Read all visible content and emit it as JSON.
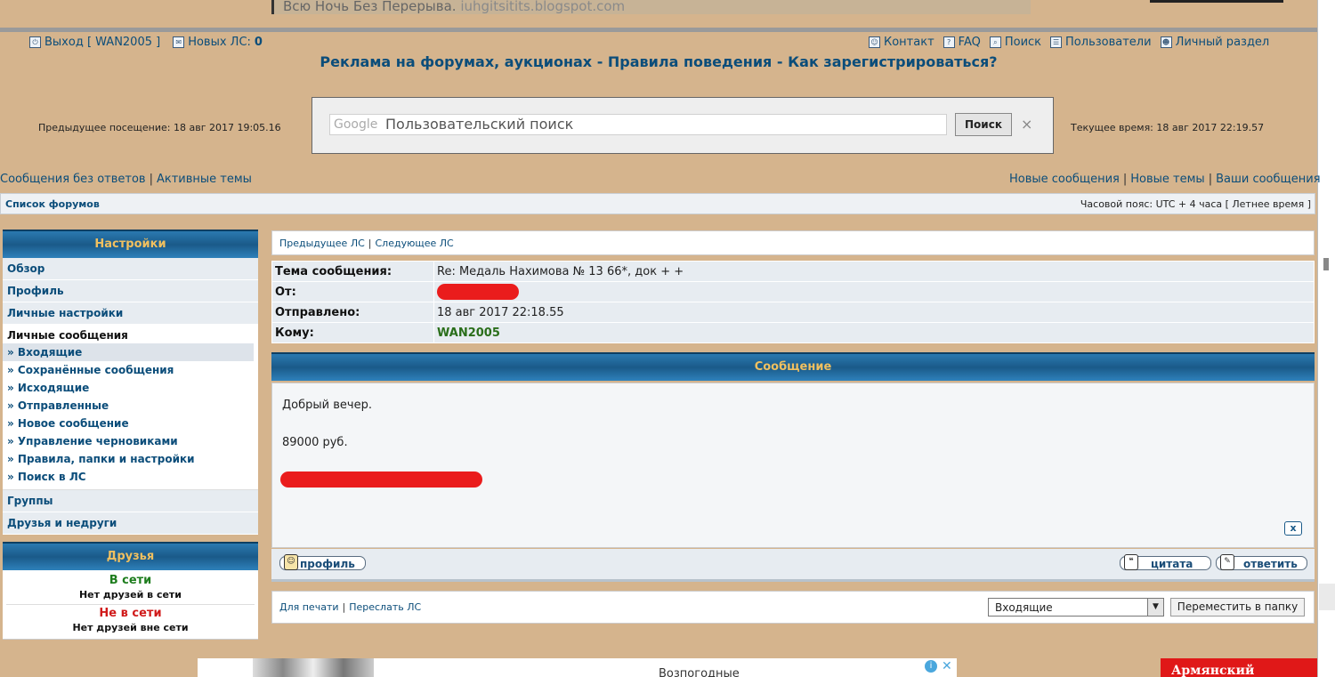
{
  "top_banner": {
    "text": "Всю Ночь Без Перерыва.",
    "link": "iuhgitsitits.blogspot.com"
  },
  "header": {
    "logout": "Выход [ WAN2005 ]",
    "new_pm_label": "Новых ЛС:",
    "new_pm_count": "0",
    "nav": {
      "contact": "Контакт",
      "faq": "FAQ",
      "search": "Поиск",
      "users": "Пользователи",
      "personal": "Личный раздел"
    },
    "headline_1": "Реклама на форумах, аукционах",
    "headline_sep1": " - ",
    "headline_2": "Правила поведения",
    "headline_sep2": " - ",
    "headline_3": "Как зарегистрироваться?",
    "prev_visit": "Предыдущее посещение: 18 авг 2017 19:05.16",
    "current_time": "Текущее время: 18 авг 2017 22:19.57"
  },
  "search": {
    "brand": "Google",
    "placeholder": "Пользовательский поиск",
    "button": "Поиск",
    "close": "×"
  },
  "quick_links": {
    "unanswered": "Сообщения без ответов",
    "active": "Активные темы",
    "new_posts": "Новые сообщения",
    "new_topics": "Новые темы",
    "your_posts": "Ваши сообщения"
  },
  "crumb": {
    "forums": "Список форумов",
    "timezone": "Часовой пояс: UTC + 4 часа [ Летнее время ]"
  },
  "sidebar": {
    "title": "Настройки",
    "items": [
      "Обзор",
      "Профиль",
      "Личные настройки"
    ],
    "pm_title": "Личные сообщения",
    "pm_links": [
      "» Входящие",
      "» Сохранённые сообщения",
      "» Исходящие",
      "» Отправленные",
      "» Новое сообщение",
      "» Управление черновиками",
      "» Правила, папки и настройки",
      "» Поиск в ЛС"
    ],
    "items2": [
      "Группы",
      "Друзья и недруги"
    ],
    "friends_title": "Друзья",
    "online": "В сети",
    "online_none": "Нет друзей в сети",
    "offline": "Не в сети",
    "offline_none": "Нет друзей вне сети"
  },
  "pm_nav": {
    "prev": "Предыдущее ЛС",
    "next": "Следующее ЛС"
  },
  "message": {
    "subject_label": "Тема сообщения:",
    "subject": "Re: Медаль Нахимова № 13 66*, док + +",
    "from_label": "От:",
    "sent_label": "Отправлено:",
    "sent": "18 авг 2017 22:18.55",
    "to_label": "Кому:",
    "to": "WAN2005",
    "header": "Сообщение",
    "line1": "Добрый вечер.",
    "line2": "89000 руб.",
    "report": "x"
  },
  "buttons": {
    "profile": "профиль",
    "quote": "цитата",
    "reply": "ответить"
  },
  "bottom": {
    "print": "Для печати",
    "forward": "Переслать ЛС",
    "folder": "Входящие",
    "move": "Переместить в папку"
  },
  "ads": {
    "bottom_text": "Возпогодные",
    "right_text": "Армянский"
  },
  "colors": {
    "accent": "#0b4d7a",
    "page_bg": "#d5b48d",
    "header_blue": "#1a5a89",
    "redact": "#ea1c1c"
  }
}
